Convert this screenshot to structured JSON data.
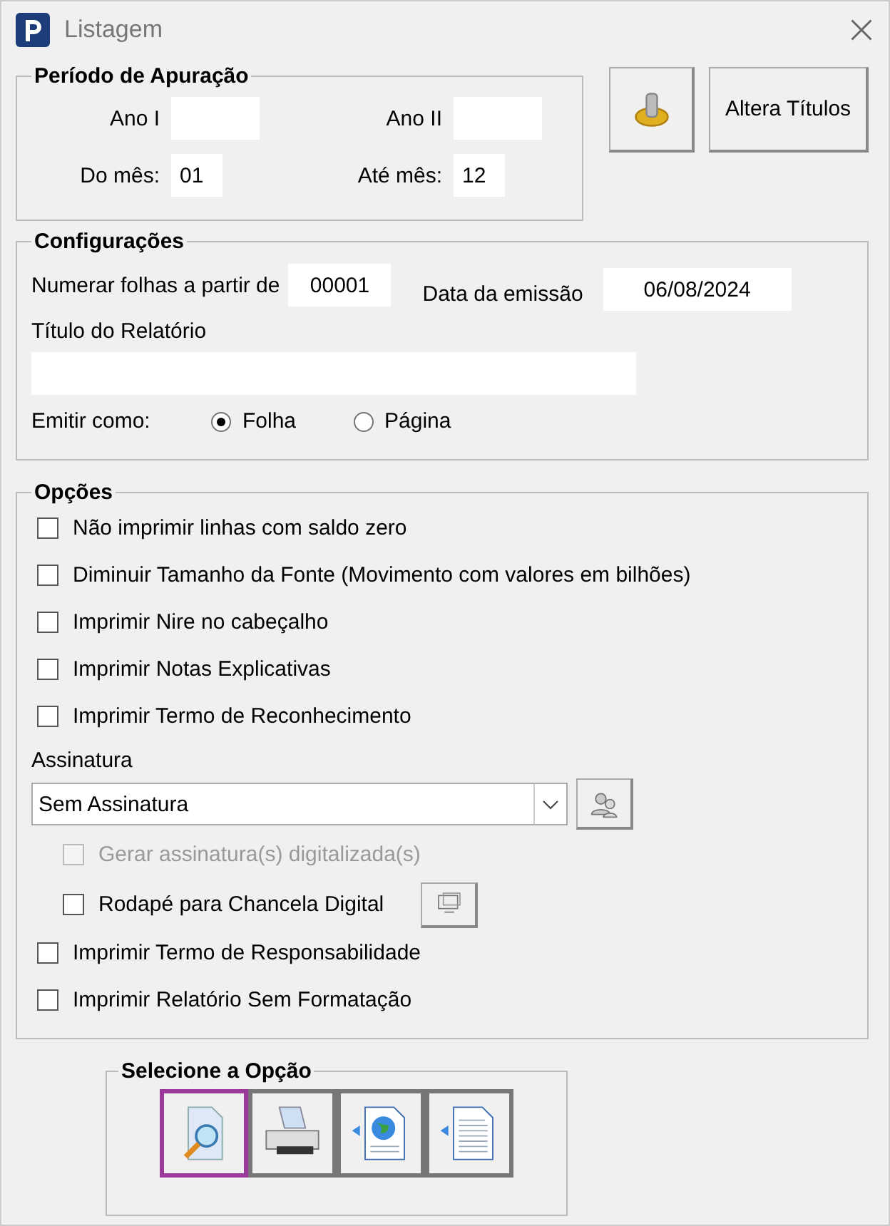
{
  "window": {
    "title": "Listagem"
  },
  "period": {
    "title": "Período de Apuração",
    "fields": [
      {
        "label": "Ano I"
      },
      {
        "label": "Ano II"
      },
      {
        "label": "Do mês:",
        "value": "01"
      },
      {
        "label": "Até mês:",
        "value": "12"
      }
    ]
  },
  "side_buttons": {
    "label": "Altera Títulos"
  },
  "config": {
    "title": "Configurações",
    "start_label": "Numerar folhas a partir de",
    "start_value": "00001",
    "date_label": "Data da emissão",
    "date_value": "06/08/2024",
    "report_title_label": "Título do Relatório",
    "emit_label": "Emitir como:",
    "emit_choices": [
      {
        "label": "Folha",
        "selected": true
      },
      {
        "label": "Página",
        "selected": false
      }
    ]
  },
  "options": {
    "title": "Opções",
    "checks": [
      {
        "label": "Não imprimir linhas com saldo zero",
        "checked": false
      },
      {
        "label": "Diminuir Tamanho da Fonte (Movimento com valores em bilhões)",
        "checked": false
      },
      {
        "label": "Imprimir Nire no cabeçalho",
        "checked": false
      },
      {
        "label": "Imprimir Notas Explicativas",
        "checked": false
      },
      {
        "label": "Imprimir Termo de Reconhecimento",
        "checked": false
      }
    ],
    "signature_label": "Assinatura",
    "signature_value": "Sem Assinatura",
    "sub_checks": [
      {
        "label": "Gerar assinatura(s) digitalizada(s)",
        "checked": false,
        "disabled": true,
        "kind": "plain"
      },
      {
        "label": "Rodapé para Chancela Digital",
        "checked": false,
        "disabled": false,
        "kind": "with_button"
      }
    ],
    "more_checks": [
      {
        "label": "Imprimir Termo de Responsabilidade",
        "checked": false
      },
      {
        "label": "Imprimir Relatório Sem Formatação",
        "checked": false
      }
    ]
  },
  "output": {
    "title": "Selecione a Opção",
    "buttons": [
      {
        "kind": "preview",
        "selected": true
      },
      {
        "kind": "print",
        "selected": false
      },
      {
        "kind": "web",
        "selected": false
      },
      {
        "kind": "text",
        "selected": false
      }
    ]
  }
}
